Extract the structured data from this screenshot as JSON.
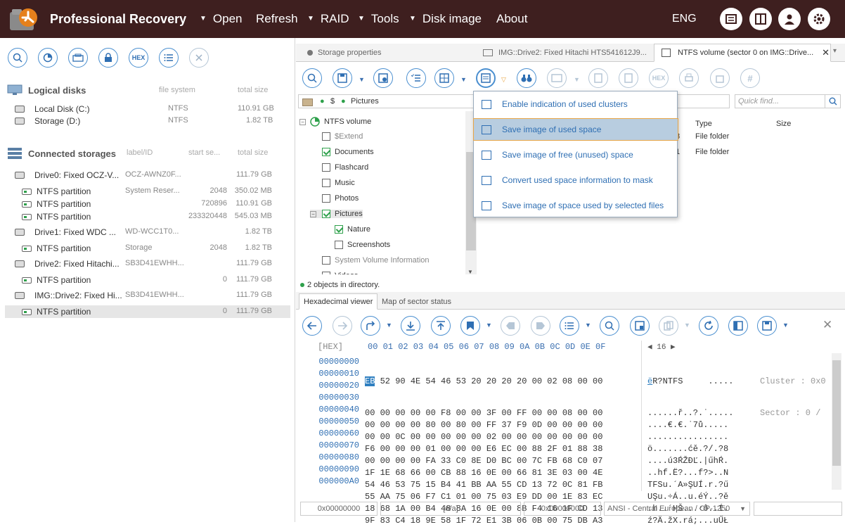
{
  "app": {
    "title": "Professional Recovery"
  },
  "menu": [
    {
      "label": "Open",
      "dropdown": true
    },
    {
      "label": "Refresh",
      "dropdown": false
    },
    {
      "label": "RAID",
      "dropdown": true
    },
    {
      "label": "Tools",
      "dropdown": true
    },
    {
      "label": "Disk image",
      "dropdown": false
    },
    {
      "label": "About",
      "dropdown": false
    }
  ],
  "lang": "ENG",
  "left": {
    "hex_label": "HEX",
    "logical_disks": {
      "title": "Logical disks",
      "col_fs": "file system",
      "col_size": "total size",
      "items": [
        {
          "name": "Local Disk (C:)",
          "fs": "NTFS",
          "size": "110.91 GB"
        },
        {
          "name": "Storage (D:)",
          "fs": "NTFS",
          "size": "1.82 TB"
        }
      ]
    },
    "storages": {
      "title": "Connected storages",
      "col_label": "label/ID",
      "col_start": "start se...",
      "col_size": "total size",
      "rows": [
        {
          "type": "drive",
          "name": "Drive0: Fixed OCZ-V...",
          "label": "OCZ-AWNZ0F...",
          "start": "",
          "size": "111.79 GB"
        },
        {
          "type": "part",
          "name": "NTFS partition",
          "label": "System Reser...",
          "start": "2048",
          "size": "350.02 MB"
        },
        {
          "type": "part",
          "name": "NTFS partition",
          "label": "",
          "start": "720896",
          "size": "110.91 GB"
        },
        {
          "type": "part",
          "name": "NTFS partition",
          "label": "",
          "start": "233320448",
          "size": "545.03 MB"
        },
        {
          "type": "drive",
          "name": "Drive1: Fixed WDC ...",
          "label": "WD-WCC1T0...",
          "start": "",
          "size": "1.82 TB"
        },
        {
          "type": "part",
          "name": "NTFS partition",
          "label": "Storage",
          "start": "2048",
          "size": "1.82 TB"
        },
        {
          "type": "drive",
          "name": "Drive2: Fixed Hitachi...",
          "label": "SB3D41EWHH...",
          "start": "",
          "size": "111.79 GB"
        },
        {
          "type": "part",
          "name": "NTFS partition",
          "label": "",
          "start": "0",
          "size": "111.79 GB"
        },
        {
          "type": "drive",
          "name": "IMG::Drive2: Fixed Hi...",
          "label": "SB3D41EWHH...",
          "start": "",
          "size": "111.79 GB"
        },
        {
          "type": "part",
          "name": "NTFS partition",
          "label": "",
          "start": "0",
          "size": "111.79 GB",
          "selected": true
        }
      ]
    }
  },
  "tabs": [
    {
      "label": "Storage properties"
    },
    {
      "label": "IMG::Drive2: Fixed Hitachi HTS541612J9..."
    },
    {
      "label": "NTFS volume (sector 0 on IMG::Drive..."
    }
  ],
  "path": {
    "root": "$",
    "current": "Pictures"
  },
  "find_placeholder": "Quick find...",
  "tree": {
    "root": "NTFS volume",
    "items": [
      {
        "label": "$Extend",
        "checked": false,
        "level": 1,
        "grey": true
      },
      {
        "label": "Documents",
        "checked": true,
        "level": 1
      },
      {
        "label": "Flashcard",
        "checked": false,
        "level": 1
      },
      {
        "label": "Music",
        "checked": false,
        "level": 1
      },
      {
        "label": "Photos",
        "checked": false,
        "level": 1
      },
      {
        "label": "Pictures",
        "checked": true,
        "level": 1,
        "expanded": true
      },
      {
        "label": "Nature",
        "checked": true,
        "level": 2
      },
      {
        "label": "Screenshots",
        "checked": false,
        "level": 2
      },
      {
        "label": "System Volume Information",
        "checked": false,
        "level": 1,
        "grey": true
      },
      {
        "label": "Videos",
        "checked": false,
        "level": 1
      }
    ]
  },
  "filelist": {
    "col_type": "Type",
    "col_size": "Size",
    "rows": [
      {
        "tail": "8",
        "type": "File folder"
      },
      {
        "tail": "1",
        "type": "File folder"
      }
    ]
  },
  "status": "2 objects in directory.",
  "popup": {
    "items": [
      "Enable indication of used clusters",
      "Save image of used space",
      "Save image of free (unused) space",
      "Convert used space information to mask",
      "Save image of space used by selected files"
    ],
    "highlighted": 1
  },
  "hex_tabs": [
    "Hexadecimal viewer",
    "Map of sector status"
  ],
  "hex": {
    "header_label": "[HEX]",
    "header_cols": "00 01 02 03 04 05 06 07 08 09 0A 0B 0C 0D 0E 0F",
    "page_nav": "◀ 16 ▶",
    "offsets": [
      "00000000",
      "00000010",
      "00000020",
      "00000030",
      "00000040",
      "00000050",
      "00000060",
      "00000070",
      "00000080",
      "00000090",
      "000000A0"
    ],
    "first_byte": "EB",
    "first_row_rest": " 52 90 4E 54 46 53 20 20 20 20 00 02 08 00 00",
    "rows_rest": [
      "00 00 00 00 00 F8 00 00 3F 00 FF 00 00 08 00 00",
      "00 00 00 00 80 00 80 00 FF 37 F9 0D 00 00 00 00",
      "00 00 0C 00 00 00 00 00 02 00 00 00 00 00 00 00",
      "F6 00 00 00 01 00 00 00 E6 EC 00 88 2F 01 88 38",
      "00 00 00 00 FA 33 C0 8E D0 BC 00 7C FB 68 C0 07",
      "1F 1E 68 66 00 CB 88 16 0E 00 66 81 3E 03 00 4E",
      "54 46 53 75 15 B4 41 BB AA 55 CD 13 72 0C 81 FB",
      "55 AA 75 06 F7 C1 01 00 75 03 E9 DD 00 1E 83 EC",
      "18 68 1A 00 B4 48 8A 16 0E 00 8B F4 16 1F CD 13",
      "9F 83 C4 18 9E 58 1F 72 E1 3B 06 0B 00 75 DB A3"
    ],
    "ascii_first_char": "ë",
    "ascii_first_rest": "R?NTFS     .....",
    "ascii_rest": [
      "......ř..?.˙.....",
      "....€.€.˙7ů.....",
      "................",
      "ö.......ćě.?/.?8",
      "....ú3ŔŽĐĽ.|űhŔ.",
      "..hf.Ë?...f?>..N",
      "TFSu.´A»ŞUÍ.r.?ű",
      "UŞu.÷Á..u.éÝ..?ě",
      ".h..´HŠ...‹ô..Í.",
      "ź?Ä.žX.rá;...uŰŁ"
    ],
    "info_lines": [
      "Cluster : 0x0",
      "Sector : 0 /"
    ]
  },
  "bottom": {
    "offset": "0x00000000",
    "na": "[n/a]",
    "value": "0x00000000",
    "encoding": "ANSI - Central European / CP-1250"
  },
  "colors": {
    "topbar": "#3e1f1f",
    "accent": "#2f6fb3",
    "green": "#2ea04b",
    "highlight": "#b8cde0"
  }
}
